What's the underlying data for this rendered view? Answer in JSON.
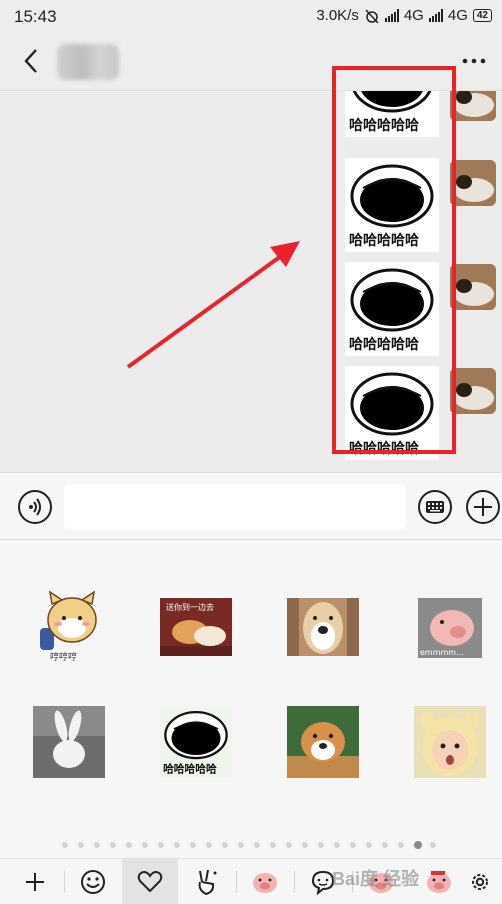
{
  "status_bar": {
    "time": "15:43",
    "network_speed": "3.0K/s",
    "network_type_1": "4G",
    "network_type_2": "4G",
    "battery": "42"
  },
  "header": {
    "back_icon": "chevron-left-icon",
    "more_icon": "more-dots-icon"
  },
  "chat": {
    "sticker_caption": "哈哈哈哈哈",
    "sticker_count": 4,
    "highlight_color": "#e8232b",
    "arrow_color": "#e8232b"
  },
  "input_bar": {
    "voice_icon": "voice-icon",
    "keyboard_icon": "keyboard-icon",
    "plus_icon": "plus-circle-icon"
  },
  "sticker_panel": {
    "stickers": [
      {
        "name": "cat-sticker",
        "caption": "哼哼哼"
      },
      {
        "name": "dogs-sticker",
        "caption": "送你到一边去"
      },
      {
        "name": "shiba-face-sticker",
        "caption": ""
      },
      {
        "name": "pig-sticker",
        "caption": "emmmm..."
      },
      {
        "name": "rabbit-sticker",
        "caption": ""
      },
      {
        "name": "laughing-face-sticker",
        "caption": "哈哈哈哈哈"
      },
      {
        "name": "shiba-sticker",
        "caption": ""
      },
      {
        "name": "baby-sticker",
        "caption": ""
      }
    ],
    "page_count": 24,
    "active_page": 22
  },
  "tabs": [
    {
      "name": "tab-add",
      "icon": "plus-icon"
    },
    {
      "name": "tab-emoji",
      "icon": "smiley-icon"
    },
    {
      "name": "tab-favorites",
      "icon": "heart-icon",
      "selected": true
    },
    {
      "name": "tab-gesture",
      "icon": "peace-hand-icon"
    },
    {
      "name": "tab-pig",
      "icon": "pig-icon"
    },
    {
      "name": "tab-chat-face",
      "icon": "speech-face-icon"
    },
    {
      "name": "tab-pig-2",
      "icon": "pig-icon"
    },
    {
      "name": "tab-pig-3",
      "icon": "pig-icon"
    },
    {
      "name": "tab-settings",
      "icon": "gear-icon"
    }
  ],
  "watermark": {
    "text": "Bai度 经验"
  }
}
